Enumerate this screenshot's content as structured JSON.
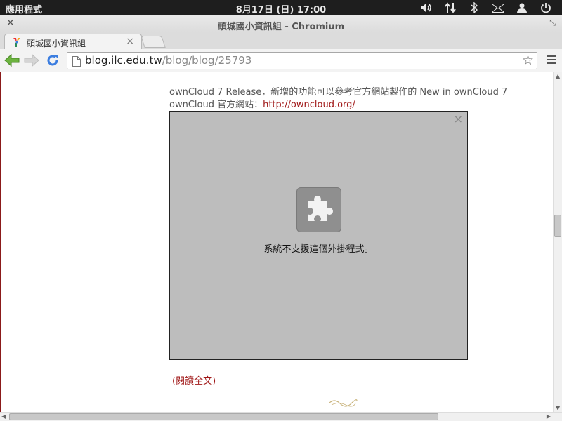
{
  "system_panel": {
    "apps_menu": "應用程式",
    "clock": "8月17日 (日) 17:00"
  },
  "window": {
    "title": "頭城國小資訊組 - Chromium"
  },
  "tabs": [
    {
      "label": "頭城國小資訊組"
    }
  ],
  "omnibox": {
    "host": "blog.ilc.edu.tw",
    "path": "/blog/blog/25793"
  },
  "post": {
    "line1": "ownCloud 7 Release，新增的功能可以參考官方網站製作的 New in ownCloud 7",
    "line2_prefix": "ownCloud 官方網站：",
    "line2_link": "http://owncloud.org/",
    "plugin_message": "系統不支援這個外掛程式。",
    "read_more": "(閱讀全文)"
  },
  "colors": {
    "accent_link": "#a01818",
    "panel_bg": "#1e1e1e"
  },
  "icons": [
    "volume-icon",
    "network-icon",
    "bluetooth-icon",
    "mail-icon",
    "user-icon",
    "power-icon",
    "puzzle-plugin-icon",
    "star-icon",
    "reload-icon"
  ]
}
